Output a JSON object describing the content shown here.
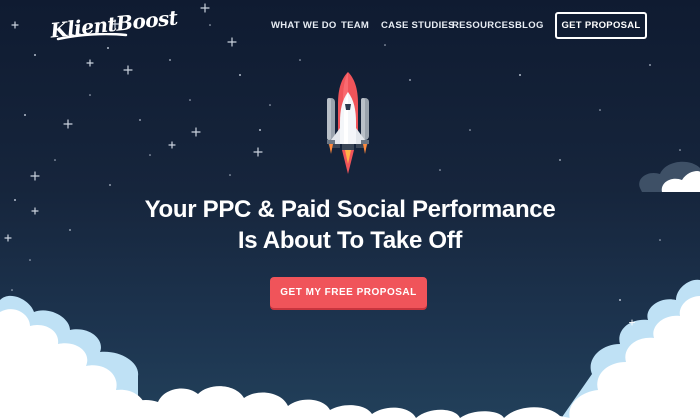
{
  "brand": {
    "logo_text": "KlientBoost"
  },
  "nav": {
    "items": [
      {
        "label": "WHAT WE DO"
      },
      {
        "label": "TEAM"
      },
      {
        "label": "CASE STUDIES"
      },
      {
        "label": "RESOURCES"
      },
      {
        "label": "BLOG"
      }
    ],
    "cta_label": "GET PROPOSAL"
  },
  "hero": {
    "headline_line1": "Your PPC & Paid Social Performance",
    "headline_line2": "Is About To Take Off",
    "cta_label": "GET MY FREE PROPOSAL"
  },
  "colors": {
    "background_top": "#0f1b31",
    "background_bottom": "#22405a",
    "accent": "#f0545a",
    "text": "#ffffff"
  },
  "icons": [
    "rocket-icon",
    "cloud-icon",
    "star-icon"
  ]
}
